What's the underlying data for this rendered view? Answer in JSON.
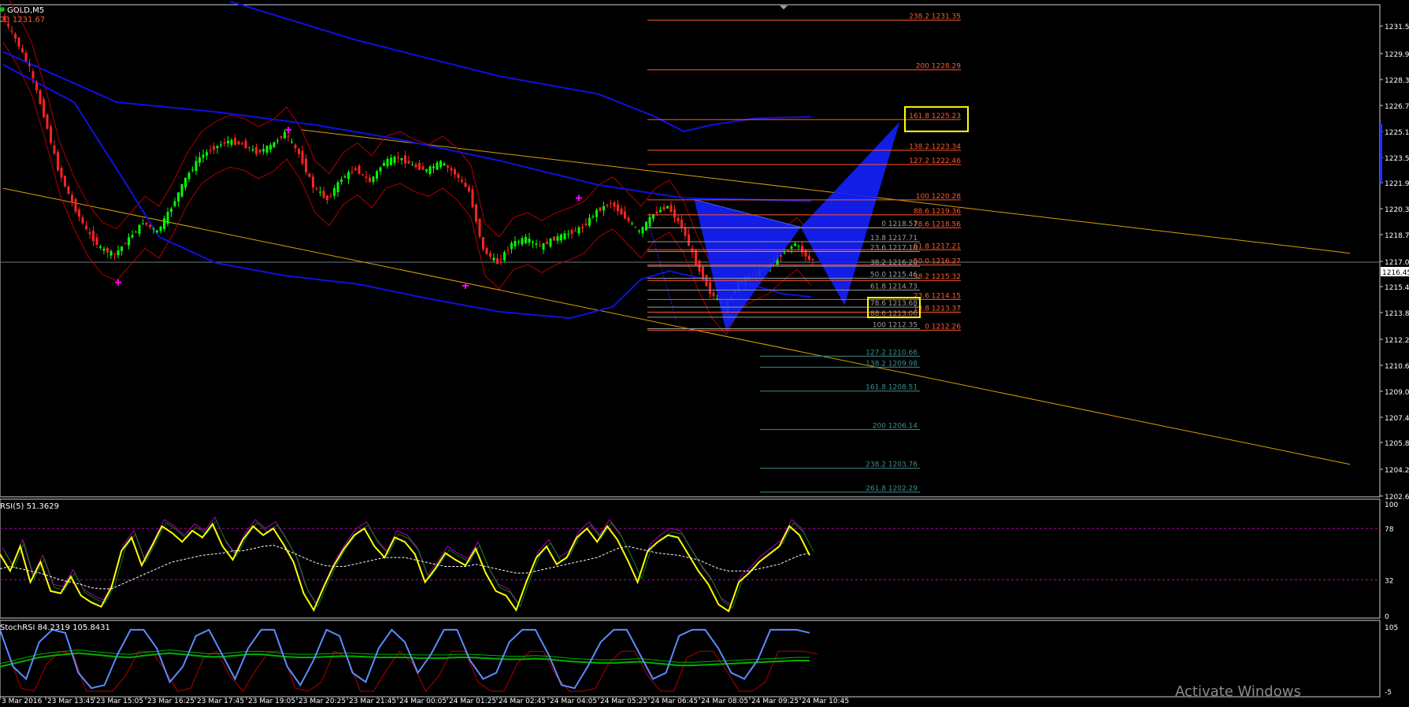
{
  "colors": {
    "background": "#000000",
    "bull_candle": "#00ff00",
    "bear_candle": "#ff2222",
    "ma_blue": "#1010e0",
    "bollinger": "#b00000",
    "channel": "#d8a000",
    "fib_upper": "#ff5a28",
    "fib_lower": "#3a8f8f",
    "fib_mid": "#9a9a9a",
    "pattern_fill": "#1420ff",
    "highlight_box": "#ffff00",
    "rsi_line": "#ffff00",
    "rsi_signal": "#ffffff",
    "rsi_level": "#b000b0",
    "stoch_main": "#5a8cff",
    "stoch_signal": "#00b000",
    "stoch_red": "#b00000",
    "axis_text": "#ffffff"
  },
  "header": {
    "symbol": "GOLD,M5",
    "price_tag": "23 1231.67"
  },
  "price_axis": {
    "labels": [
      "1231.5",
      "1229.9",
      "1228.3",
      "1226.7",
      "1225.1",
      "1223.5",
      "1221.9",
      "1220.3",
      "1218.7",
      "1217.0",
      "1216.45",
      "1215.4",
      "1213.8",
      "1212.2",
      "1210.6",
      "1209.0",
      "1207.4",
      "1205.8",
      "1204.2",
      "1202.6"
    ]
  },
  "time_axis": {
    "labels": [
      "3 Mar 2016",
      "23 Mar 13:45",
      "23 Mar 15:05",
      "23 Mar 16:25",
      "23 Mar 17:45",
      "23 Mar 19:05",
      "23 Mar 20:25",
      "23 Mar 21:45",
      "24 Mar 00:05",
      "24 Mar 01:25",
      "24 Mar 02:45",
      "24 Mar 04:05",
      "24 Mar 05:25",
      "24 Mar 06:45",
      "24 Mar 08:05",
      "24 Mar 09:25",
      "24 Mar 10:45"
    ]
  },
  "fib_upper": [
    {
      "label": "238.2 1231.35",
      "price": 1231.35
    },
    {
      "label": "200 1228.29",
      "price": 1228.29
    },
    {
      "label": "161.8 1225.23",
      "price": 1225.23
    },
    {
      "label": "138.2 1223.34",
      "price": 1223.34
    },
    {
      "label": "127.2 1222.46",
      "price": 1222.46
    },
    {
      "label": "100 1220.28",
      "price": 1220.28
    },
    {
      "label": "88.6 1219.36",
      "price": 1219.36
    },
    {
      "label": "78.6 1218.56",
      "price": 1218.56
    },
    {
      "label": "61.8 1217.21",
      "price": 1217.21
    },
    {
      "label": "50.0 1216.27",
      "price": 1216.27
    },
    {
      "label": "38.2 1215.32",
      "price": 1215.32
    },
    {
      "label": "23.6 1214.15",
      "price": 1214.15
    },
    {
      "label": "13.8 1213.37",
      "price": 1213.37
    },
    {
      "label": "0 1212.26",
      "price": 1212.26
    }
  ],
  "fib_lower": [
    {
      "label": "0 1218.57",
      "price": 1218.57
    },
    {
      "label": "13.8 1217.71",
      "price": 1217.71
    },
    {
      "label": "23.6 1217.10",
      "price": 1217.1
    },
    {
      "label": "38.2 1216.20",
      "price": 1216.2
    },
    {
      "label": "50.0 1215.46",
      "price": 1215.46
    },
    {
      "label": "61.8 1214.73",
      "price": 1214.73
    },
    {
      "label": "78.6 1213.68",
      "price": 1213.68
    },
    {
      "label": "88.6 1213.06",
      "price": 1213.06
    },
    {
      "label": "100 1212.35",
      "price": 1212.35
    },
    {
      "label": "127.2 1210.66",
      "price": 1210.66
    },
    {
      "label": "138.2 1209.98",
      "price": 1209.98
    },
    {
      "label": "161.8 1208.51",
      "price": 1208.51
    },
    {
      "label": "200 1206.14",
      "price": 1206.14
    },
    {
      "label": "238.2 1203.76",
      "price": 1203.76
    },
    {
      "label": "261.8 1202.29",
      "price": 1202.29
    }
  ],
  "rsi": {
    "label": "RSI(5) 51.3629",
    "axis_labels": [
      "100",
      "78",
      "32",
      "0"
    ],
    "levels": [
      78,
      32
    ]
  },
  "stoch": {
    "label": "StochRSI 84.2319 105.8431",
    "axis_labels": [
      "105",
      "-5"
    ]
  },
  "watermark": "Activate Windows",
  "chart_data": {
    "type": "candlestick",
    "title": "GOLD,M5",
    "ylim": [
      1202.0,
      1232.3
    ],
    "current_price": 1216.45,
    "close_path": [
      [
        0,
        1231.6
      ],
      [
        2,
        1230.2
      ],
      [
        4,
        1228.4
      ],
      [
        6,
        1225.5
      ],
      [
        8,
        1222.2
      ],
      [
        10,
        1220.1
      ],
      [
        12,
        1218.4
      ],
      [
        14,
        1217.3
      ],
      [
        16,
        1216.9
      ],
      [
        18,
        1217.9
      ],
      [
        20,
        1218.9
      ],
      [
        22,
        1218.3
      ],
      [
        24,
        1219.8
      ],
      [
        26,
        1221.6
      ],
      [
        28,
        1222.9
      ],
      [
        30,
        1223.5
      ],
      [
        32,
        1223.9
      ],
      [
        34,
        1223.7
      ],
      [
        36,
        1223.2
      ],
      [
        38,
        1223.6
      ],
      [
        40,
        1224.4
      ],
      [
        42,
        1223.1
      ],
      [
        44,
        1221.1
      ],
      [
        46,
        1220.3
      ],
      [
        48,
        1221.6
      ],
      [
        50,
        1222.2
      ],
      [
        52,
        1221.4
      ],
      [
        54,
        1222.6
      ],
      [
        56,
        1222.9
      ],
      [
        58,
        1222.4
      ],
      [
        60,
        1222.1
      ],
      [
        62,
        1222.6
      ],
      [
        64,
        1221.9
      ],
      [
        66,
        1220.8
      ],
      [
        68,
        1217.2
      ],
      [
        70,
        1216.4
      ],
      [
        72,
        1217.6
      ],
      [
        74,
        1217.9
      ],
      [
        76,
        1217.4
      ],
      [
        78,
        1217.9
      ],
      [
        80,
        1218.2
      ],
      [
        82,
        1218.6
      ],
      [
        84,
        1219.6
      ],
      [
        86,
        1220.1
      ],
      [
        88,
        1219.2
      ],
      [
        90,
        1218.3
      ],
      [
        92,
        1219.4
      ],
      [
        94,
        1219.9
      ],
      [
        96,
        1218.6
      ],
      [
        98,
        1216.4
      ],
      [
        100,
        1214.6
      ],
      [
        102,
        1213.6
      ],
      [
        104,
        1215.2
      ],
      [
        106,
        1215.7
      ],
      [
        108,
        1216.1
      ],
      [
        110,
        1216.9
      ],
      [
        112,
        1217.6
      ],
      [
        114,
        1216.6
      ]
    ],
    "blue_ma_fast": [
      [
        0,
        1228.6
      ],
      [
        10,
        1226.3
      ],
      [
        16,
        1222.2
      ],
      [
        22,
        1218.0
      ],
      [
        30,
        1216.4
      ],
      [
        40,
        1215.6
      ],
      [
        50,
        1215.1
      ],
      [
        60,
        1214.2
      ],
      [
        70,
        1213.4
      ],
      [
        80,
        1213.0
      ],
      [
        86,
        1213.7
      ],
      [
        90,
        1215.4
      ],
      [
        94,
        1215.9
      ],
      [
        100,
        1215.3
      ],
      [
        106,
        1215.0
      ],
      [
        110,
        1214.5
      ],
      [
        114,
        1214.3
      ]
    ],
    "blue_ma_slow": [
      [
        32,
        1232.5
      ],
      [
        50,
        1230.1
      ],
      [
        70,
        1227.9
      ],
      [
        84,
        1226.8
      ],
      [
        92,
        1225.4
      ],
      [
        96,
        1224.5
      ],
      [
        100,
        1224.9
      ],
      [
        106,
        1225.3
      ],
      [
        114,
        1225.4
      ]
    ],
    "blue_ma_mid": [
      [
        0,
        1229.4
      ],
      [
        16,
        1226.3
      ],
      [
        30,
        1225.7
      ],
      [
        44,
        1224.9
      ],
      [
        56,
        1224.0
      ],
      [
        70,
        1222.7
      ],
      [
        84,
        1221.2
      ],
      [
        96,
        1220.4
      ],
      [
        106,
        1220.3
      ],
      [
        114,
        1220.2
      ]
    ],
    "channel_upper": [
      [
        42,
        1224.6
      ],
      [
        190,
        1217.0
      ]
    ],
    "channel_lower": [
      [
        0,
        1221.0
      ],
      [
        190,
        1204.0
      ]
    ],
    "rsi_series": [
      55,
      40,
      62,
      30,
      48,
      22,
      20,
      35,
      18,
      12,
      8,
      25,
      58,
      70,
      45,
      62,
      80,
      74,
      66,
      76,
      70,
      82,
      62,
      50,
      68,
      80,
      72,
      78,
      64,
      48,
      20,
      5,
      26,
      45,
      60,
      72,
      78,
      62,
      52,
      70,
      66,
      55,
      30,
      42,
      56,
      50,
      45,
      60,
      38,
      22,
      18,
      5,
      30,
      52,
      62,
      46,
      52,
      70,
      78,
      66,
      80,
      68,
      50,
      30,
      58,
      66,
      72,
      70,
      55,
      40,
      28,
      10,
      4,
      30,
      38,
      48,
      55,
      62,
      80,
      72,
      54
    ],
    "rsi_signal_series": [
      42,
      44,
      42,
      40,
      38,
      35,
      32,
      30,
      28,
      25,
      24,
      24,
      28,
      32,
      36,
      40,
      44,
      48,
      50,
      52,
      54,
      55,
      56,
      58,
      58,
      60,
      62,
      63,
      60,
      56,
      52,
      48,
      45,
      44,
      44,
      46,
      48,
      50,
      52,
      52,
      52,
      50,
      48,
      46,
      44,
      44,
      44,
      46,
      44,
      42,
      40,
      38,
      38,
      40,
      42,
      44,
      46,
      48,
      50,
      52,
      56,
      60,
      62,
      60,
      58,
      56,
      55,
      54,
      52,
      50,
      46,
      42,
      40,
      40,
      40,
      42,
      44,
      46,
      50,
      54,
      56
    ],
    "stoch_series": [
      100,
      40,
      20,
      80,
      100,
      95,
      30,
      5,
      10,
      60,
      100,
      100,
      70,
      15,
      40,
      90,
      100,
      60,
      20,
      70,
      100,
      100,
      40,
      10,
      50,
      100,
      90,
      30,
      15,
      70,
      100,
      80,
      30,
      60,
      100,
      100,
      50,
      20,
      30,
      80,
      100,
      100,
      60,
      10,
      5,
      40,
      80,
      100,
      100,
      60,
      20,
      30,
      90,
      100,
      100,
      70,
      30,
      20,
      50,
      100,
      100,
      100,
      95
    ],
    "stoch_signal_series": [
      40,
      45,
      50,
      55,
      58,
      60,
      62,
      60,
      58,
      56,
      55,
      58,
      60,
      62,
      60,
      58,
      56,
      56,
      58,
      60,
      60,
      58,
      56,
      55,
      55,
      56,
      57,
      57,
      56,
      55,
      55,
      55,
      54,
      54,
      54,
      55,
      55,
      54,
      53,
      52,
      52,
      53,
      52,
      50,
      48,
      47,
      46,
      46,
      47,
      48,
      46,
      44,
      42,
      42,
      43,
      44,
      45,
      46,
      47,
      48,
      49,
      50,
      50
    ]
  }
}
